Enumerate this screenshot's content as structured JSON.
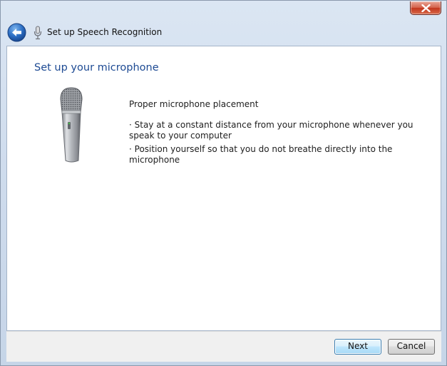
{
  "window": {
    "title": "Set up Speech Recognition",
    "close_icon": "close-icon",
    "back_icon": "back-arrow-icon",
    "app_icon": "microphone-icon"
  },
  "page": {
    "heading": "Set up your microphone",
    "illustration": "handheld-microphone",
    "placement_title": "Proper microphone placement",
    "bullets": [
      "· Stay at a constant distance from your microphone whenever you speak to your computer",
      "· Position yourself so that you do not breathe directly into the microphone"
    ]
  },
  "footer": {
    "next_label": "Next",
    "cancel_label": "Cancel"
  },
  "colors": {
    "heading": "#1d4a93",
    "close_button": "#c7432a",
    "back_button": "#2d6fc4"
  }
}
